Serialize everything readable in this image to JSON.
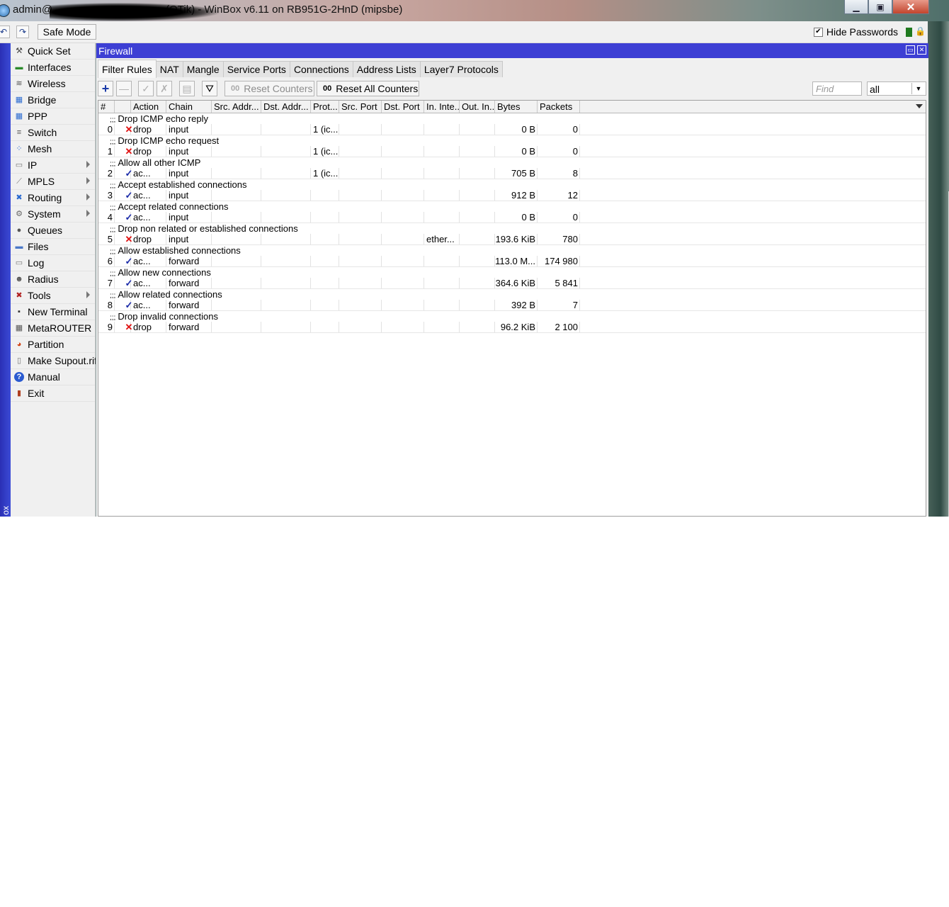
{
  "window": {
    "title": "admin@                                   [OTik] - WinBox v6.11 on RB951G-2HnD (mipsbe)",
    "title_prefix": "admin@",
    "title_suffix": "(OTik) - WinBox v6.11 on RB951G-2HnD (mipsbe)"
  },
  "toolbar": {
    "safe_mode_label": "Safe Mode",
    "hide_passwords_label": "Hide Passwords",
    "hide_passwords_checked": true
  },
  "left_strip_text": "ox",
  "sidebar": {
    "items": [
      {
        "label": "Quick Set",
        "icon": "quick-set-icon",
        "submenu": false
      },
      {
        "label": "Interfaces",
        "icon": "interfaces-icon",
        "submenu": false
      },
      {
        "label": "Wireless",
        "icon": "wireless-icon",
        "submenu": false
      },
      {
        "label": "Bridge",
        "icon": "bridge-icon",
        "submenu": false
      },
      {
        "label": "PPP",
        "icon": "ppp-icon",
        "submenu": false
      },
      {
        "label": "Switch",
        "icon": "switch-icon",
        "submenu": false
      },
      {
        "label": "Mesh",
        "icon": "mesh-icon",
        "submenu": false
      },
      {
        "label": "IP",
        "icon": "ip-icon",
        "submenu": true
      },
      {
        "label": "MPLS",
        "icon": "mpls-icon",
        "submenu": true
      },
      {
        "label": "Routing",
        "icon": "routing-icon",
        "submenu": true
      },
      {
        "label": "System",
        "icon": "system-icon",
        "submenu": true
      },
      {
        "label": "Queues",
        "icon": "queues-icon",
        "submenu": false
      },
      {
        "label": "Files",
        "icon": "files-icon",
        "submenu": false
      },
      {
        "label": "Log",
        "icon": "log-icon",
        "submenu": false
      },
      {
        "label": "Radius",
        "icon": "radius-icon",
        "submenu": false
      },
      {
        "label": "Tools",
        "icon": "tools-icon",
        "submenu": true
      },
      {
        "label": "New Terminal",
        "icon": "terminal-icon",
        "submenu": false
      },
      {
        "label": "MetaROUTER",
        "icon": "metarouter-icon",
        "submenu": false
      },
      {
        "label": "Partition",
        "icon": "partition-icon",
        "submenu": false
      },
      {
        "label": "Make Supout.rif",
        "icon": "supout-icon",
        "submenu": false
      },
      {
        "label": "Manual",
        "icon": "manual-icon",
        "submenu": false
      },
      {
        "label": "Exit",
        "icon": "exit-icon",
        "submenu": false
      }
    ]
  },
  "firewall": {
    "title": "Firewall",
    "tabs": [
      "Filter Rules",
      "NAT",
      "Mangle",
      "Service Ports",
      "Connections",
      "Address Lists",
      "Layer7 Protocols"
    ],
    "active_tab": "Filter Rules",
    "reset_counters_label": "Reset Counters",
    "reset_all_counters_label": "Reset All Counters",
    "reset_all_counters_icon": "00",
    "find_placeholder": "Find",
    "filter_value": "all",
    "columns": [
      "#",
      "",
      "Action",
      "Chain",
      "Src. Addr...",
      "Dst. Addr...",
      "Prot...",
      "Src. Port",
      "Dst. Port",
      "In. Inte...",
      "Out. In...",
      "Bytes",
      "Packets"
    ],
    "comment_prefix": ";;;",
    "rules": [
      {
        "comment": "Drop ICMP echo reply",
        "num": "0",
        "action_type": "drop",
        "action": "drop",
        "chain": "input",
        "src": "",
        "dst": "",
        "proto": "1 (ic...",
        "sport": "",
        "dport": "",
        "in": "",
        "out": "",
        "bytes": "0 B",
        "packets": "0"
      },
      {
        "comment": "Drop ICMP echo request",
        "num": "1",
        "action_type": "drop",
        "action": "drop",
        "chain": "input",
        "src": "",
        "dst": "",
        "proto": "1 (ic...",
        "sport": "",
        "dport": "",
        "in": "",
        "out": "",
        "bytes": "0 B",
        "packets": "0"
      },
      {
        "comment": "Allow all other ICMP",
        "num": "2",
        "action_type": "accept",
        "action": "ac...",
        "chain": "input",
        "src": "",
        "dst": "",
        "proto": "1 (ic...",
        "sport": "",
        "dport": "",
        "in": "",
        "out": "",
        "bytes": "705 B",
        "packets": "8"
      },
      {
        "comment": "Accept established connections",
        "num": "3",
        "action_type": "accept",
        "action": "ac...",
        "chain": "input",
        "src": "",
        "dst": "",
        "proto": "",
        "sport": "",
        "dport": "",
        "in": "",
        "out": "",
        "bytes": "912 B",
        "packets": "12"
      },
      {
        "comment": "Accept related connections",
        "num": "4",
        "action_type": "accept",
        "action": "ac...",
        "chain": "input",
        "src": "",
        "dst": "",
        "proto": "",
        "sport": "",
        "dport": "",
        "in": "",
        "out": "",
        "bytes": "0 B",
        "packets": "0"
      },
      {
        "comment": "Drop non related or established connections",
        "num": "5",
        "action_type": "drop",
        "action": "drop",
        "chain": "input",
        "src": "",
        "dst": "",
        "proto": "",
        "sport": "",
        "dport": "",
        "in": "ether...",
        "out": "",
        "bytes": "193.6 KiB",
        "packets": "780"
      },
      {
        "comment": "Allow established connections",
        "num": "6",
        "action_type": "accept",
        "action": "ac...",
        "chain": "forward",
        "src": "",
        "dst": "",
        "proto": "",
        "sport": "",
        "dport": "",
        "in": "",
        "out": "",
        "bytes": "113.0 M...",
        "packets": "174 980"
      },
      {
        "comment": "Allow new connections",
        "num": "7",
        "action_type": "accept",
        "action": "ac...",
        "chain": "forward",
        "src": "",
        "dst": "",
        "proto": "",
        "sport": "",
        "dport": "",
        "in": "",
        "out": "",
        "bytes": "364.6 KiB",
        "packets": "5 841"
      },
      {
        "comment": "Allow related connections",
        "num": "8",
        "action_type": "accept",
        "action": "ac...",
        "chain": "forward",
        "src": "",
        "dst": "",
        "proto": "",
        "sport": "",
        "dport": "",
        "in": "",
        "out": "",
        "bytes": "392 B",
        "packets": "7"
      },
      {
        "comment": "Drop invalid connections",
        "num": "9",
        "action_type": "drop",
        "action": "drop",
        "chain": "forward",
        "src": "",
        "dst": "",
        "proto": "",
        "sport": "",
        "dport": "",
        "in": "",
        "out": "",
        "bytes": "96.2 KiB",
        "packets": "2 100"
      }
    ]
  },
  "colors": {
    "title_accent": "#3d3fd4",
    "drop_mark": "#e01010",
    "accept_mark": "#1a2aa8"
  }
}
